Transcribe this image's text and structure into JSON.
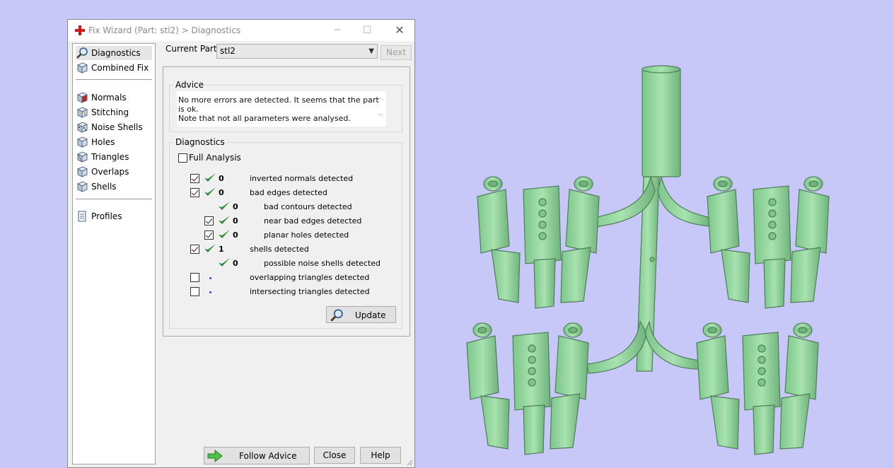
{
  "window": {
    "title": "Fix Wizard (Part: stl2) > Diagnostics",
    "minimize_glyph": "─",
    "maximize_glyph": "☐",
    "close_glyph": "✕"
  },
  "nav": {
    "items_top": [
      {
        "label": "Diagnostics",
        "icon": "magnifier-icon"
      },
      {
        "label": "Combined Fix",
        "icon": "cube-icon"
      }
    ],
    "items_mid": [
      {
        "label": "Normals",
        "icon": "cube-red-icon"
      },
      {
        "label": "Stitching",
        "icon": "cube-icon"
      },
      {
        "label": "Noise Shells",
        "icon": "noise-cube-icon"
      },
      {
        "label": "Holes",
        "icon": "cube-icon"
      },
      {
        "label": "Triangles",
        "icon": "cube-icon"
      },
      {
        "label": "Overlaps",
        "icon": "cube-icon"
      },
      {
        "label": "Shells",
        "icon": "cube-icon"
      }
    ],
    "items_bottom": [
      {
        "label": "Profiles",
        "icon": "document-icon"
      }
    ]
  },
  "current_part": {
    "label": "Current Part:",
    "value": "stl2",
    "next_label": "Next"
  },
  "advice": {
    "title": "Advice",
    "line1": "No more errors are detected. It seems that the part is ok.",
    "line2": "Note that not all parameters were analysed."
  },
  "diagnostics": {
    "title": "Diagnostics",
    "full_analysis_label": "Full Analysis",
    "full_analysis_checked": false,
    "rows": [
      {
        "checked": true,
        "status": "ok",
        "count": "0",
        "text": "inverted normals detected",
        "indent": 0,
        "has_checkbox": true
      },
      {
        "checked": true,
        "status": "ok",
        "count": "0",
        "text": "bad edges detected",
        "indent": 0,
        "has_checkbox": true
      },
      {
        "checked": false,
        "status": "ok",
        "count": "0",
        "text": "bad contours detected",
        "indent": 1,
        "has_checkbox": false
      },
      {
        "checked": true,
        "status": "ok",
        "count": "0",
        "text": "near bad edges detected",
        "indent": 1,
        "has_checkbox": true
      },
      {
        "checked": true,
        "status": "ok",
        "count": "0",
        "text": "planar holes detected",
        "indent": 1,
        "has_checkbox": true
      },
      {
        "checked": true,
        "status": "ok",
        "count": "1",
        "text": "shells detected",
        "indent": 0,
        "has_checkbox": true
      },
      {
        "checked": false,
        "status": "ok",
        "count": "0",
        "text": "possible noise shells detected",
        "indent": 1,
        "has_checkbox": false
      },
      {
        "checked": false,
        "status": "pending",
        "count": "",
        "text": "overlapping triangles detected",
        "indent": 0,
        "has_checkbox": true
      },
      {
        "checked": false,
        "status": "pending",
        "count": "",
        "text": "intersecting triangles detected",
        "indent": 0,
        "has_checkbox": true
      }
    ],
    "update_label": "Update"
  },
  "footer": {
    "follow_advice_label": "Follow Advice",
    "close_label": "Close",
    "help_label": "Help"
  },
  "colors": {
    "viewport_bg": "#c8c8f8",
    "model_fill": "#8fd49a",
    "model_stroke": "#4e7e58",
    "tick_green": "#2e8b3a"
  }
}
